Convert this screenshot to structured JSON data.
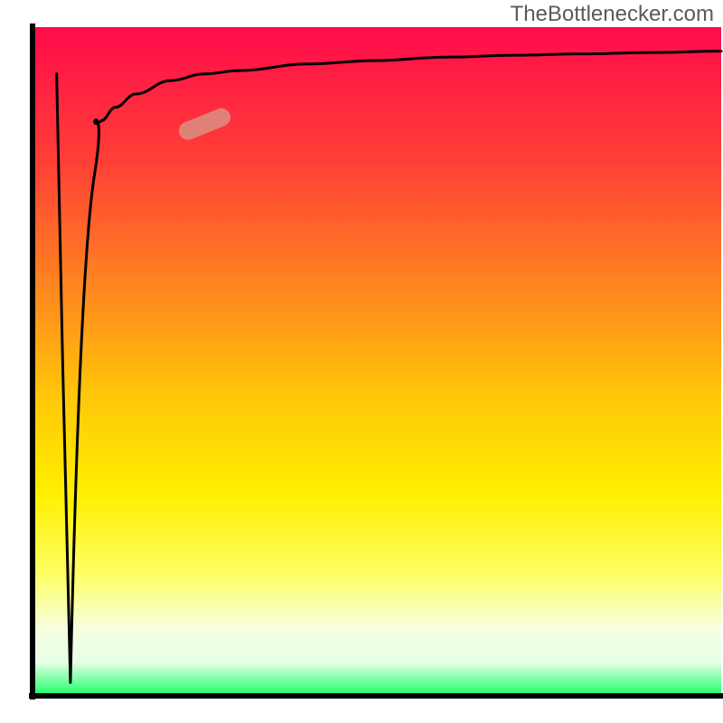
{
  "watermark": "TheBottlenecker.com",
  "chart_data": {
    "type": "line",
    "title": "",
    "xlabel": "",
    "ylabel": "",
    "xlim": [
      0,
      100
    ],
    "ylim": [
      0,
      100
    ],
    "x": [
      0,
      2,
      3,
      4,
      5,
      6,
      8,
      10,
      12,
      15,
      20,
      25,
      30,
      40,
      50,
      60,
      70,
      80,
      90,
      100
    ],
    "values": [
      0,
      98,
      70,
      50,
      35,
      25,
      18,
      14,
      12,
      10,
      8,
      7,
      6.5,
      5.5,
      5,
      4.5,
      4.2,
      4,
      3.8,
      3.6
    ],
    "marker": {
      "x": 25,
      "y_curve": 14.5
    },
    "gradient_stops": [
      {
        "offset": 0.0,
        "color": "#ff0b4b"
      },
      {
        "offset": 0.2,
        "color": "#ff3f36"
      },
      {
        "offset": 0.4,
        "color": "#ff8a1d"
      },
      {
        "offset": 0.55,
        "color": "#ffc60a"
      },
      {
        "offset": 0.7,
        "color": "#fff000"
      },
      {
        "offset": 0.82,
        "color": "#fdff66"
      },
      {
        "offset": 0.9,
        "color": "#f6ffe0"
      },
      {
        "offset": 0.95,
        "color": "#e6ffe6"
      },
      {
        "offset": 1.0,
        "color": "#17ff64"
      }
    ]
  }
}
